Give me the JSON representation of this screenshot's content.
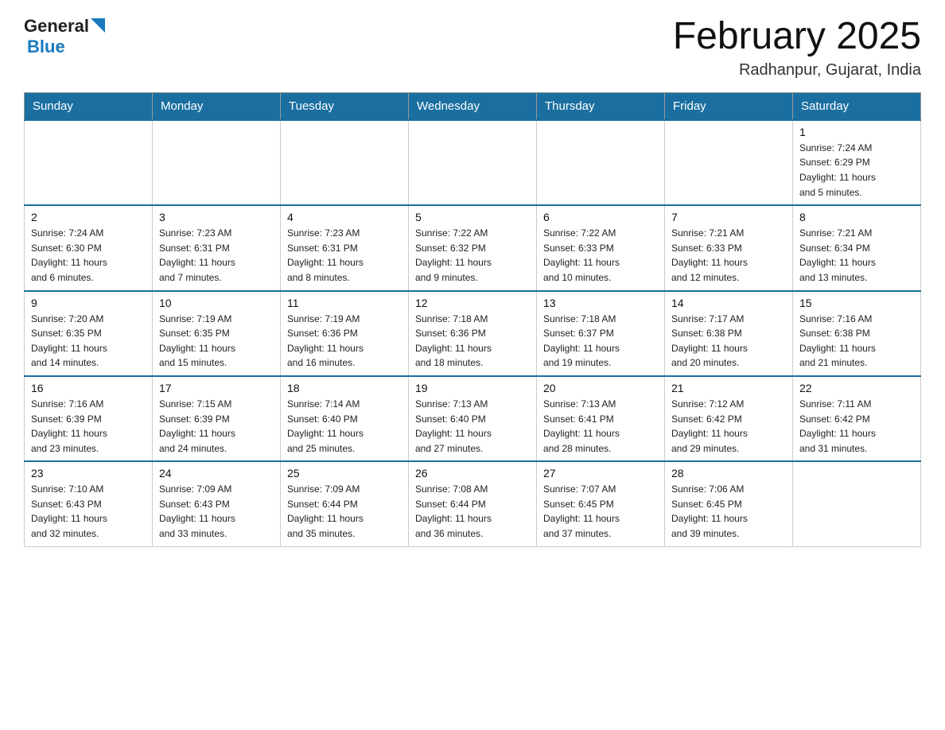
{
  "header": {
    "logo_general": "General",
    "logo_blue": "Blue",
    "month_title": "February 2025",
    "location": "Radhanpur, Gujarat, India"
  },
  "weekdays": [
    "Sunday",
    "Monday",
    "Tuesday",
    "Wednesday",
    "Thursday",
    "Friday",
    "Saturday"
  ],
  "weeks": [
    [
      {
        "day": "",
        "info": ""
      },
      {
        "day": "",
        "info": ""
      },
      {
        "day": "",
        "info": ""
      },
      {
        "day": "",
        "info": ""
      },
      {
        "day": "",
        "info": ""
      },
      {
        "day": "",
        "info": ""
      },
      {
        "day": "1",
        "info": "Sunrise: 7:24 AM\nSunset: 6:29 PM\nDaylight: 11 hours\nand 5 minutes."
      }
    ],
    [
      {
        "day": "2",
        "info": "Sunrise: 7:24 AM\nSunset: 6:30 PM\nDaylight: 11 hours\nand 6 minutes."
      },
      {
        "day": "3",
        "info": "Sunrise: 7:23 AM\nSunset: 6:31 PM\nDaylight: 11 hours\nand 7 minutes."
      },
      {
        "day": "4",
        "info": "Sunrise: 7:23 AM\nSunset: 6:31 PM\nDaylight: 11 hours\nand 8 minutes."
      },
      {
        "day": "5",
        "info": "Sunrise: 7:22 AM\nSunset: 6:32 PM\nDaylight: 11 hours\nand 9 minutes."
      },
      {
        "day": "6",
        "info": "Sunrise: 7:22 AM\nSunset: 6:33 PM\nDaylight: 11 hours\nand 10 minutes."
      },
      {
        "day": "7",
        "info": "Sunrise: 7:21 AM\nSunset: 6:33 PM\nDaylight: 11 hours\nand 12 minutes."
      },
      {
        "day": "8",
        "info": "Sunrise: 7:21 AM\nSunset: 6:34 PM\nDaylight: 11 hours\nand 13 minutes."
      }
    ],
    [
      {
        "day": "9",
        "info": "Sunrise: 7:20 AM\nSunset: 6:35 PM\nDaylight: 11 hours\nand 14 minutes."
      },
      {
        "day": "10",
        "info": "Sunrise: 7:19 AM\nSunset: 6:35 PM\nDaylight: 11 hours\nand 15 minutes."
      },
      {
        "day": "11",
        "info": "Sunrise: 7:19 AM\nSunset: 6:36 PM\nDaylight: 11 hours\nand 16 minutes."
      },
      {
        "day": "12",
        "info": "Sunrise: 7:18 AM\nSunset: 6:36 PM\nDaylight: 11 hours\nand 18 minutes."
      },
      {
        "day": "13",
        "info": "Sunrise: 7:18 AM\nSunset: 6:37 PM\nDaylight: 11 hours\nand 19 minutes."
      },
      {
        "day": "14",
        "info": "Sunrise: 7:17 AM\nSunset: 6:38 PM\nDaylight: 11 hours\nand 20 minutes."
      },
      {
        "day": "15",
        "info": "Sunrise: 7:16 AM\nSunset: 6:38 PM\nDaylight: 11 hours\nand 21 minutes."
      }
    ],
    [
      {
        "day": "16",
        "info": "Sunrise: 7:16 AM\nSunset: 6:39 PM\nDaylight: 11 hours\nand 23 minutes."
      },
      {
        "day": "17",
        "info": "Sunrise: 7:15 AM\nSunset: 6:39 PM\nDaylight: 11 hours\nand 24 minutes."
      },
      {
        "day": "18",
        "info": "Sunrise: 7:14 AM\nSunset: 6:40 PM\nDaylight: 11 hours\nand 25 minutes."
      },
      {
        "day": "19",
        "info": "Sunrise: 7:13 AM\nSunset: 6:40 PM\nDaylight: 11 hours\nand 27 minutes."
      },
      {
        "day": "20",
        "info": "Sunrise: 7:13 AM\nSunset: 6:41 PM\nDaylight: 11 hours\nand 28 minutes."
      },
      {
        "day": "21",
        "info": "Sunrise: 7:12 AM\nSunset: 6:42 PM\nDaylight: 11 hours\nand 29 minutes."
      },
      {
        "day": "22",
        "info": "Sunrise: 7:11 AM\nSunset: 6:42 PM\nDaylight: 11 hours\nand 31 minutes."
      }
    ],
    [
      {
        "day": "23",
        "info": "Sunrise: 7:10 AM\nSunset: 6:43 PM\nDaylight: 11 hours\nand 32 minutes."
      },
      {
        "day": "24",
        "info": "Sunrise: 7:09 AM\nSunset: 6:43 PM\nDaylight: 11 hours\nand 33 minutes."
      },
      {
        "day": "25",
        "info": "Sunrise: 7:09 AM\nSunset: 6:44 PM\nDaylight: 11 hours\nand 35 minutes."
      },
      {
        "day": "26",
        "info": "Sunrise: 7:08 AM\nSunset: 6:44 PM\nDaylight: 11 hours\nand 36 minutes."
      },
      {
        "day": "27",
        "info": "Sunrise: 7:07 AM\nSunset: 6:45 PM\nDaylight: 11 hours\nand 37 minutes."
      },
      {
        "day": "28",
        "info": "Sunrise: 7:06 AM\nSunset: 6:45 PM\nDaylight: 11 hours\nand 39 minutes."
      },
      {
        "day": "",
        "info": ""
      }
    ]
  ]
}
